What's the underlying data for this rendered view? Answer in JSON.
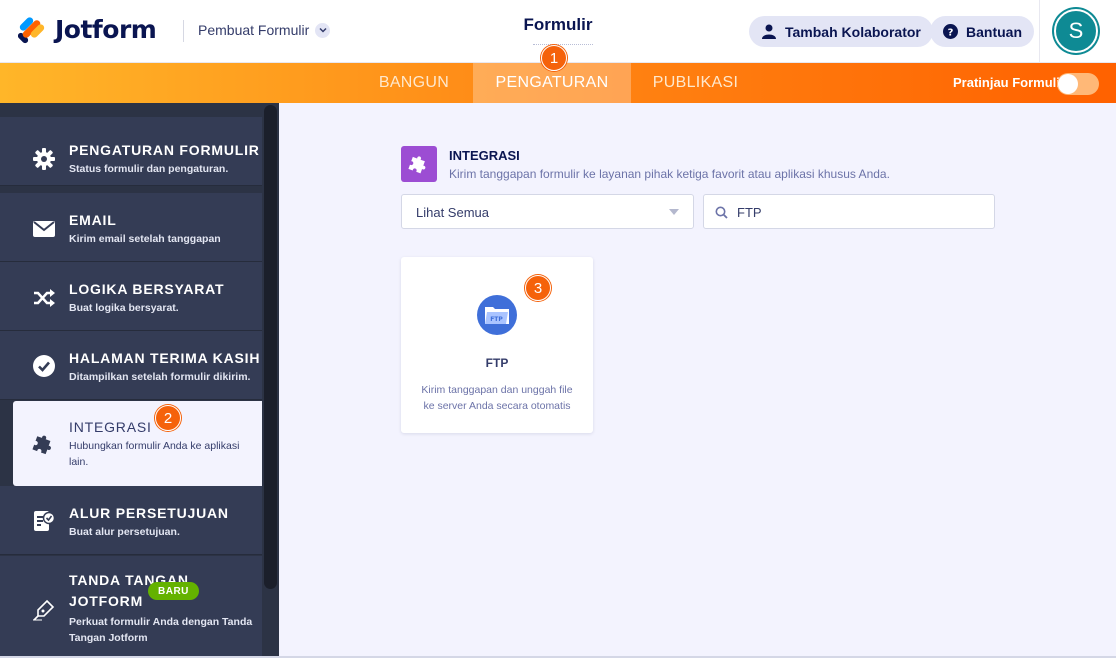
{
  "header": {
    "brand": "Jotform",
    "builder_menu": "Pembuat Formulir",
    "form_title": "Formulir",
    "collaborator_label": "Tambah Kolaborator",
    "help_label": "Bantuan",
    "avatar_initial": "S"
  },
  "navbar": {
    "tabs": [
      {
        "label": "BANGUN",
        "active": false
      },
      {
        "label": "PENGATURAN",
        "active": true
      },
      {
        "label": "PUBLIKASI",
        "active": false
      }
    ],
    "preview_label": "Pratinjau Formulir",
    "preview_enabled": false,
    "colors": {
      "gradient_start": "#ffb629",
      "gradient_end": "#ff6100"
    }
  },
  "sidebar": {
    "items": [
      {
        "title": "PENGATURAN FORMULIR",
        "desc": "Status formulir dan pengaturan.",
        "icon": "gear-icon"
      },
      {
        "title": "EMAIL",
        "desc": "Kirim email setelah tanggapan",
        "icon": "envelope-icon"
      },
      {
        "title": "LOGIKA BERSYARAT",
        "desc": "Buat logika bersyarat.",
        "icon": "shuffle-icon"
      },
      {
        "title": "HALAMAN TERIMA KASIH",
        "desc": "Ditampilkan setelah formulir dikirim.",
        "icon": "check-circle-icon"
      },
      {
        "title": "INTEGRASI",
        "desc": "Hubungkan formulir Anda ke aplikasi lain.",
        "icon": "puzzle-icon",
        "active": true
      },
      {
        "title": "ALUR PERSETUJUAN",
        "desc": "Buat alur persetujuan.",
        "icon": "approval-doc-icon"
      },
      {
        "title": "TANDA TANGAN JOTFORM",
        "title_line1": "TANDA TANGAN",
        "title_line2": "JOTFORM",
        "desc": "Perkuat formulir Anda dengan Tanda Tangan Jotform",
        "icon": "pen-nib-icon",
        "badge": "BARU"
      }
    ]
  },
  "main": {
    "section_title": "INTEGRASI",
    "section_desc": "Kirim tanggapan formulir ke layanan pihak ketiga favorit atau aplikasi khusus Anda.",
    "filter_value": "Lihat Semua",
    "search_value": "FTP",
    "cards": [
      {
        "title": "FTP",
        "desc": "Kirim tanggapan dan unggah file ke server Anda secara otomatis",
        "icon": "ftp-folder-icon"
      }
    ]
  },
  "steps": [
    "1",
    "2",
    "3"
  ],
  "colors": {
    "accent": "#f5620b",
    "integration_purple": "#9c4dd3",
    "ftp_blue": "#3f6fd9",
    "sidebar_bg": "#343c55"
  }
}
